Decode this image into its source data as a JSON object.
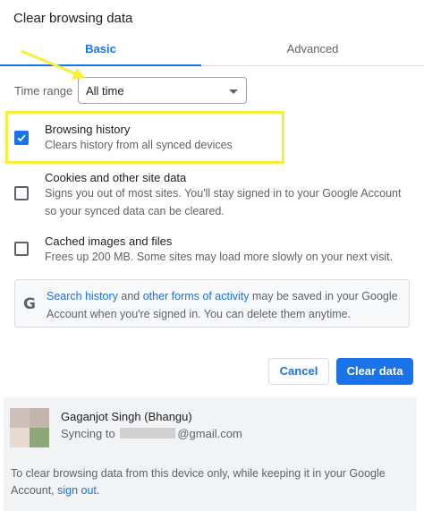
{
  "dialog": {
    "title": "Clear browsing data"
  },
  "tabs": [
    {
      "label": "Basic",
      "active": true
    },
    {
      "label": "Advanced",
      "active": false
    }
  ],
  "time_range": {
    "label": "Time range",
    "value": "All time"
  },
  "items": [
    {
      "title": "Browsing history",
      "desc": "Clears history from all synced devices",
      "checked": true
    },
    {
      "title": "Cookies and other site data",
      "desc": "Signs you out of most sites. You'll stay signed in to your Google Account so your synced data can be cleared.",
      "checked": false
    },
    {
      "title": "Cached images and files",
      "desc": "Frees up 200 MB. Some sites may load more slowly on your next visit.",
      "checked": false
    }
  ],
  "info": {
    "icon": "G",
    "link1": "Search history",
    "text1": " and ",
    "link2": "other forms of activity",
    "text2": " may be saved in your Google Account when you're signed in. You can delete them anytime."
  },
  "buttons": {
    "cancel": "Cancel",
    "clear": "Clear data"
  },
  "account": {
    "name": "Gaganjot Singh (Bhangu)",
    "sync_prefix": "Syncing to ",
    "sync_visible_start": "",
    "email_suffix": "@gmail.com"
  },
  "footer": {
    "text": "To clear browsing data from this device only, while keeping it in your Google Account, ",
    "link": "sign out",
    "end": "."
  },
  "colors": {
    "accent": "#1a73e8",
    "highlight": "#f7ef3a",
    "avatar": [
      "#cdbfb9",
      "#c4b4ae",
      "#e8d9d1",
      "#8da77a"
    ]
  }
}
